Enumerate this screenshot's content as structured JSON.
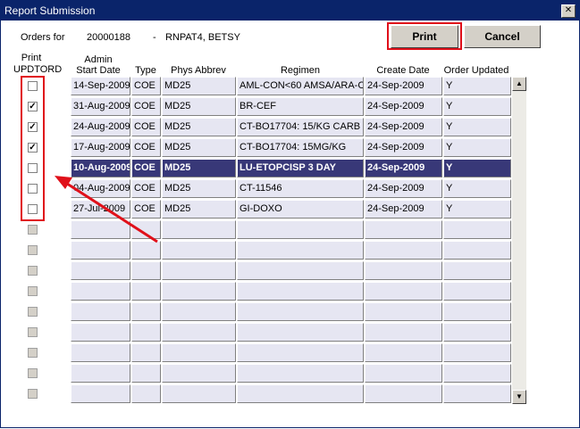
{
  "window": {
    "title": "Report Submission",
    "close_glyph": "✕"
  },
  "header": {
    "orders_for_label": "Orders for",
    "order_number": "20000188",
    "dash": "-",
    "patient": "RNPAT4, BETSY"
  },
  "buttons": {
    "print": "Print",
    "cancel": "Cancel"
  },
  "columns": {
    "print_top": "Print",
    "print_bottom": "UPDTORD",
    "admin_top": "Admin",
    "admin_bottom": "Start Date",
    "type": "Type",
    "phys": "Phys Abbrev",
    "regimen": "Regimen",
    "create": "Create Date",
    "updated": "Order Updated"
  },
  "rows": [
    {
      "checked": false,
      "selected": false,
      "admin": "14-Sep-2009",
      "type": "COE",
      "phys": "MD25",
      "regimen": "AML-CON<60 AMSA/ARA-C",
      "create": "24-Sep-2009",
      "updated": "Y"
    },
    {
      "checked": true,
      "selected": false,
      "admin": "31-Aug-2009",
      "type": "COE",
      "phys": "MD25",
      "regimen": "BR-CEF",
      "create": "24-Sep-2009",
      "updated": "Y"
    },
    {
      "checked": true,
      "selected": false,
      "admin": "24-Aug-2009",
      "type": "COE",
      "phys": "MD25",
      "regimen": "CT-BO17704: 15/KG CARB",
      "create": "24-Sep-2009",
      "updated": "Y"
    },
    {
      "checked": true,
      "selected": false,
      "admin": "17-Aug-2009",
      "type": "COE",
      "phys": "MD25",
      "regimen": "CT-BO17704: 15MG/KG",
      "create": "24-Sep-2009",
      "updated": "Y"
    },
    {
      "checked": false,
      "selected": true,
      "admin": "10-Aug-2009",
      "type": "COE",
      "phys": "MD25",
      "regimen": "LU-ETOPCISP 3 DAY",
      "create": "24-Sep-2009",
      "updated": "Y"
    },
    {
      "checked": false,
      "selected": false,
      "admin": "04-Aug-2009",
      "type": "COE",
      "phys": "MD25",
      "regimen": "CT-11546",
      "create": "24-Sep-2009",
      "updated": "Y"
    },
    {
      "checked": false,
      "selected": false,
      "admin": "27-Jul-2009",
      "type": "COE",
      "phys": "MD25",
      "regimen": "GI-DOXO",
      "create": "24-Sep-2009",
      "updated": "Y"
    }
  ],
  "empty_rows": 9,
  "scrollbar": {
    "up_glyph": "▲",
    "down_glyph": "▼"
  },
  "colors": {
    "title_bar": "#0a246a",
    "selected_row": "#383878",
    "highlight": "#e0101a",
    "cell_bg": "#e6e6f2"
  }
}
